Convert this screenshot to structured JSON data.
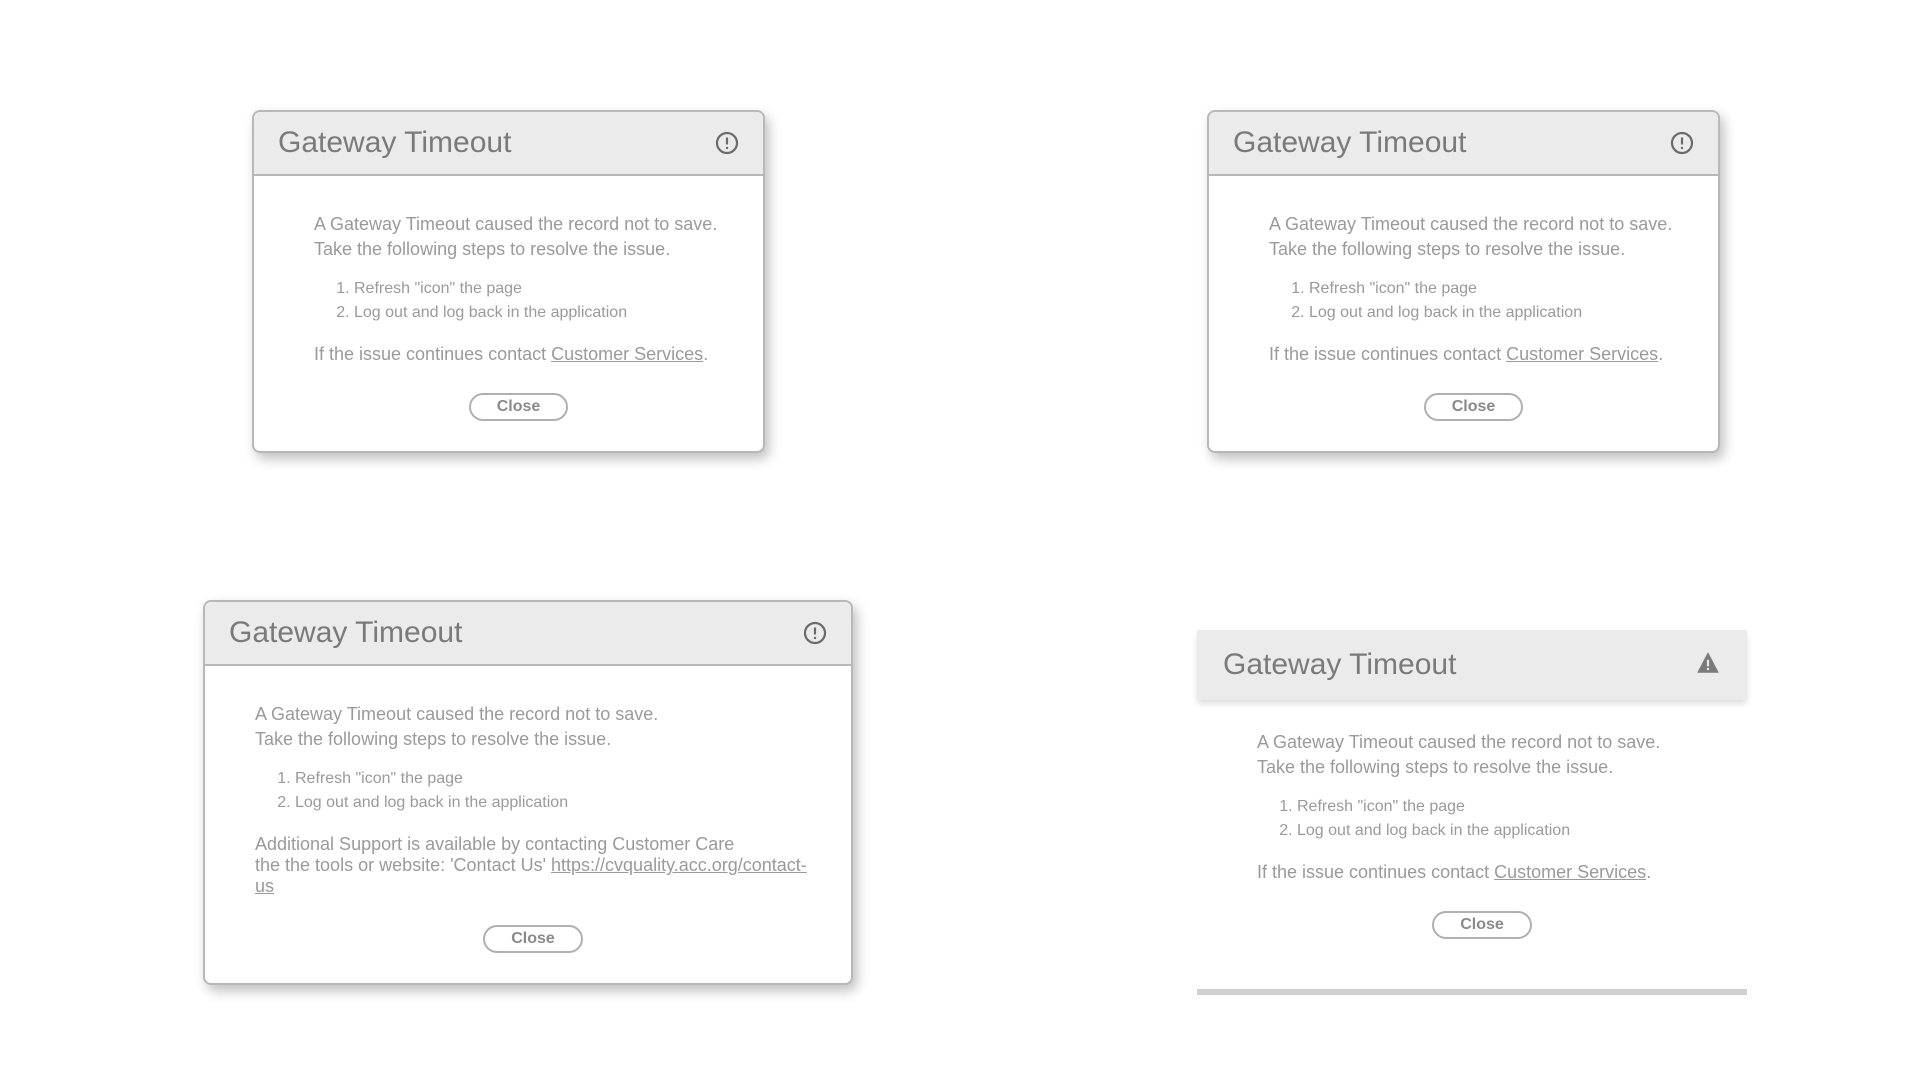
{
  "dialog1": {
    "title": "Gateway Timeout",
    "intro1": "A Gateway Timeout caused the record not to save.",
    "intro2": "Take the following steps to resolve the issue.",
    "step1": "Refresh \"icon\" the page",
    "step2": "Log out and log back in the application",
    "footer_prefix": "If the issue continues contact ",
    "footer_link": "Customer Services",
    "footer_suffix": ".",
    "close": "Close"
  },
  "dialog2": {
    "title": "Gateway Timeout",
    "intro1": "A Gateway Timeout caused the record not to save.",
    "intro2": "Take the following steps to resolve the issue.",
    "step1": "Refresh \"icon\" the page",
    "step2": "Log out and log back in the application",
    "footer_prefix": "If the issue continues contact ",
    "footer_link": "Customer Services",
    "footer_suffix": ".",
    "close": "Close"
  },
  "dialog3": {
    "title": "Gateway Timeout",
    "intro1": "A Gateway Timeout caused the record not to save.",
    "intro2": "Take the following steps to resolve the issue.",
    "step1": "Refresh \"icon\" the page",
    "step2": "Log out and log back in the application",
    "support1": "Additional Support is available by contacting Customer Care",
    "support2_prefix": "the the tools or website: 'Contact Us'  ",
    "support2_link": "https://cvquality.acc.org/contact-us",
    "close": "Close"
  },
  "dialog4": {
    "title": "Gateway Timeout",
    "intro1": "A Gateway Timeout caused the record not to save.",
    "intro2": "Take the following steps to resolve the issue.",
    "step1": "Refresh \"icon\" the page",
    "step2": "Log out and log back in the application",
    "footer_prefix": "If the issue continues contact ",
    "footer_link": "Customer Services",
    "footer_suffix": ".",
    "close": "Close"
  }
}
